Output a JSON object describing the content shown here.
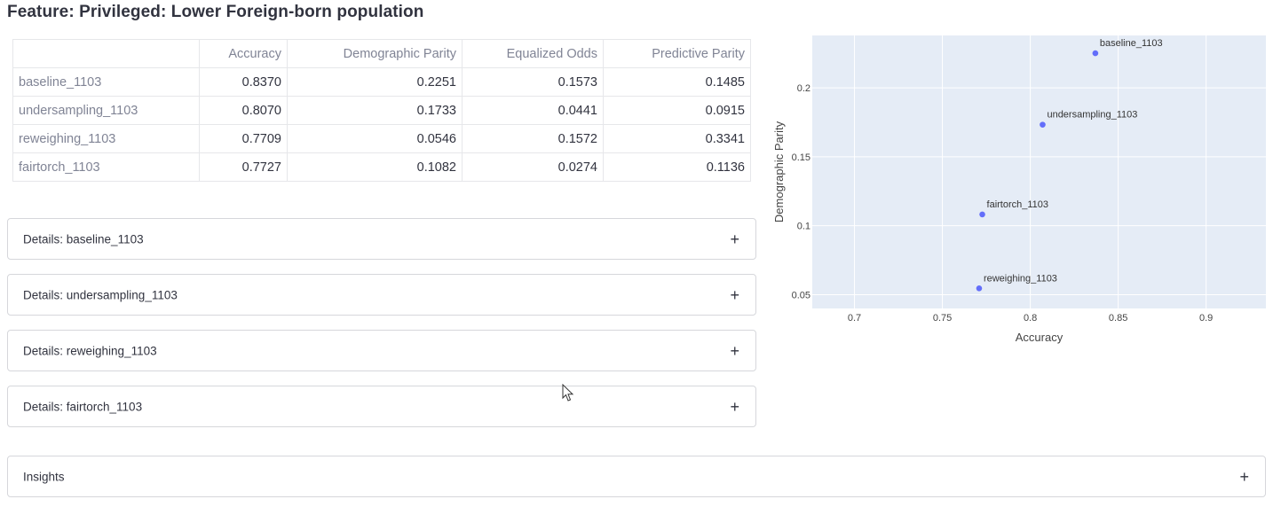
{
  "page": {
    "title": "Feature: Privileged: Lower Foreign-born population"
  },
  "table": {
    "columns": [
      "",
      "Accuracy",
      "Demographic Parity",
      "Equalized Odds",
      "Predictive Parity"
    ],
    "rows": [
      {
        "label": "baseline_1103",
        "values": [
          "0.8370",
          "0.2251",
          "0.1573",
          "0.1485"
        ]
      },
      {
        "label": "undersampling_1103",
        "values": [
          "0.8070",
          "0.1733",
          "0.0441",
          "0.0915"
        ]
      },
      {
        "label": "reweighing_1103",
        "values": [
          "0.7709",
          "0.0546",
          "0.1572",
          "0.3341"
        ]
      },
      {
        "label": "fairtorch_1103",
        "values": [
          "0.7727",
          "0.1082",
          "0.0274",
          "0.1136"
        ]
      }
    ]
  },
  "expanders": [
    {
      "label": "Details: baseline_1103",
      "icon": "plus-icon"
    },
    {
      "label": "Details: undersampling_1103",
      "icon": "plus-icon"
    },
    {
      "label": "Details: reweighing_1103",
      "icon": "plus-icon"
    },
    {
      "label": "Details: fairtorch_1103",
      "icon": "plus-icon"
    }
  ],
  "insights": {
    "label": "Insights",
    "icon": "plus-icon"
  },
  "chart_data": {
    "type": "scatter",
    "title": "",
    "xlabel": "Accuracy",
    "ylabel": "Demographic Parity",
    "xlim": [
      0.676,
      0.934
    ],
    "ylim": [
      0.04,
      0.238
    ],
    "xticks": [
      "0.7",
      "0.75",
      "0.8",
      "0.85",
      "0.9"
    ],
    "yticks": [
      "0.05",
      "0.1",
      "0.15",
      "0.2"
    ],
    "grid": true,
    "points": [
      {
        "label": "baseline_1103",
        "x": 0.837,
        "y": 0.2251
      },
      {
        "label": "undersampling_1103",
        "x": 0.807,
        "y": 0.1733
      },
      {
        "label": "reweighing_1103",
        "x": 0.7709,
        "y": 0.0546
      },
      {
        "label": "fairtorch_1103",
        "x": 0.7727,
        "y": 0.1082
      }
    ],
    "colors": {
      "marker": "#636efa",
      "plot_bg": "#e5ecf6",
      "grid": "#ffffff"
    }
  }
}
